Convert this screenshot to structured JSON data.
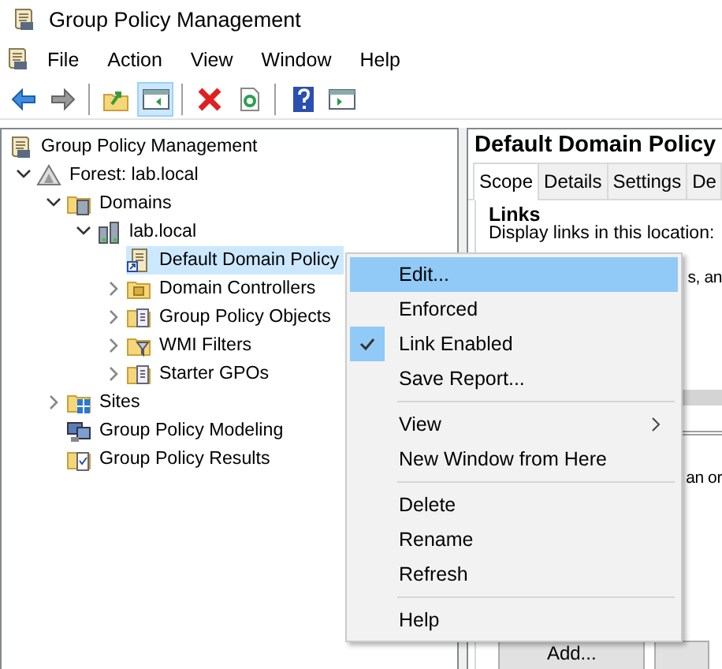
{
  "window": {
    "title": "Group Policy Management"
  },
  "menu_bar": [
    "File",
    "Action",
    "View",
    "Window",
    "Help"
  ],
  "toolbar": [
    {
      "kind": "back",
      "pressed": false
    },
    {
      "kind": "forward",
      "pressed": false
    },
    {
      "kind": "sep"
    },
    {
      "kind": "up",
      "pressed": false
    },
    {
      "kind": "tree",
      "pressed": true
    },
    {
      "kind": "sep"
    },
    {
      "kind": "delete",
      "pressed": false
    },
    {
      "kind": "refresh",
      "pressed": false
    },
    {
      "kind": "sep"
    },
    {
      "kind": "help",
      "pressed": false
    },
    {
      "kind": "action-pane",
      "pressed": false
    }
  ],
  "tree": [
    {
      "label": "Group Policy Management",
      "kind": "gpm",
      "selected": false,
      "children": [
        {
          "label": "Forest: lab.local",
          "kind": "forest",
          "selected": false,
          "expanded": true,
          "children": [
            {
              "label": "Domains",
              "kind": "domains",
              "selected": false,
              "expanded": true,
              "children": [
                {
                  "label": "lab.local",
                  "kind": "domain",
                  "selected": false,
                  "expanded": true,
                  "children": [
                    {
                      "label": "Default Domain Policy",
                      "kind": "gpo",
                      "selected": true
                    },
                    {
                      "label": "Domain Controllers",
                      "kind": "ou",
                      "selected": false,
                      "expanded": false
                    },
                    {
                      "label": "Group Policy Objects",
                      "kind": "folder-doc",
                      "selected": false,
                      "expanded": false
                    },
                    {
                      "label": "WMI Filters",
                      "kind": "folder-filter",
                      "selected": false,
                      "expanded": false
                    },
                    {
                      "label": "Starter GPOs",
                      "kind": "folder-doc",
                      "selected": false,
                      "expanded": false
                    }
                  ]
                }
              ]
            },
            {
              "label": "Sites",
              "kind": "sites",
              "selected": false,
              "expanded": false
            },
            {
              "label": "Group Policy Modeling",
              "kind": "modeling",
              "selected": false
            },
            {
              "label": "Group Policy Results",
              "kind": "results",
              "selected": false
            }
          ]
        }
      ]
    }
  ],
  "details": {
    "title": "Default Domain Policy",
    "tabs": [
      {
        "label": "Scope",
        "selected": true
      },
      {
        "label": "Details",
        "selected": false
      },
      {
        "label": "Settings",
        "selected": false
      },
      {
        "label": "De",
        "selected": false
      }
    ],
    "heading": "Links",
    "text": "Display links in this location:",
    "fragment_1": "s, an",
    "fragment_2": "an or",
    "buttons": [
      "Add..."
    ]
  },
  "context_menu": [
    {
      "kind": "item",
      "label": "Edit...",
      "selected": true,
      "checked": false
    },
    {
      "kind": "item",
      "label": "Enforced",
      "selected": false,
      "checked": false
    },
    {
      "kind": "item",
      "label": "Link Enabled",
      "selected": false,
      "checked": true
    },
    {
      "kind": "item",
      "label": "Save Report...",
      "selected": false,
      "checked": false
    },
    {
      "kind": "separator"
    },
    {
      "kind": "submenu",
      "label": "View",
      "selected": false,
      "checked": false
    },
    {
      "kind": "item",
      "label": "New Window from Here",
      "selected": false,
      "checked": false
    },
    {
      "kind": "separator"
    },
    {
      "kind": "item",
      "label": "Delete",
      "selected": false,
      "checked": false
    },
    {
      "kind": "item",
      "label": "Rename",
      "selected": false,
      "checked": false
    },
    {
      "kind": "item",
      "label": "Refresh",
      "selected": false,
      "checked": false
    },
    {
      "kind": "separator"
    },
    {
      "kind": "item",
      "label": "Help",
      "selected": false,
      "checked": false
    }
  ]
}
